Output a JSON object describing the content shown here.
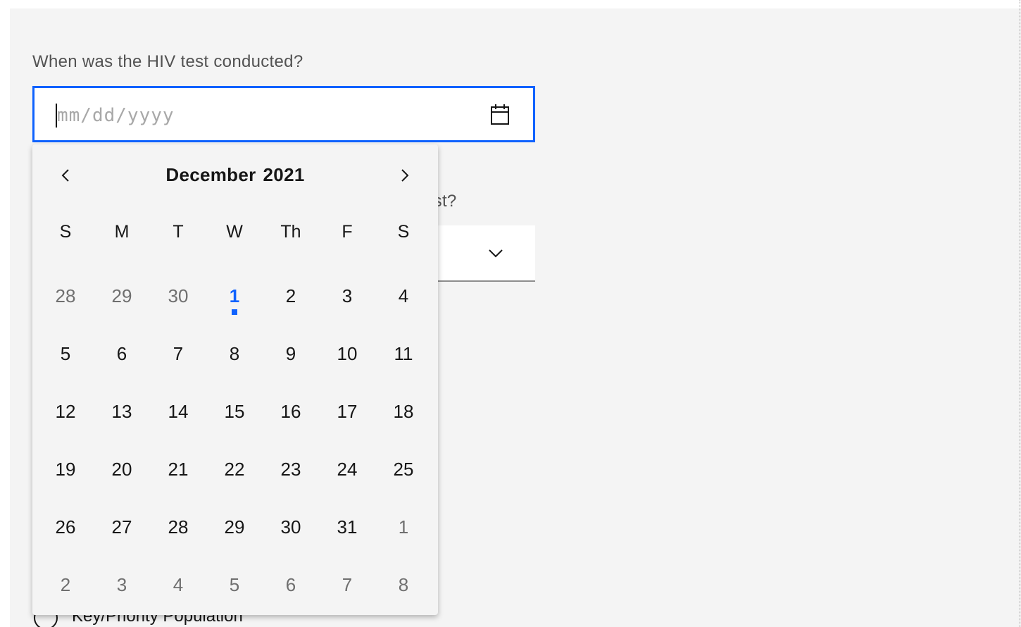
{
  "form": {
    "question1": "When was the HIV test conducted?",
    "date_placeholder": "mm/dd/yyyy",
    "question2_visible_fragment": "est?",
    "radio_option_label": "Key/Priority Population"
  },
  "icons": {
    "calendar": "calendar-icon",
    "dropdown": "chevron-down-icon",
    "prev": "chevron-left-icon",
    "next": "chevron-right-icon"
  },
  "colors": {
    "accent": "#0f62fe",
    "background": "#f4f4f4",
    "text": "#161616",
    "muted_text": "#6f6f6f",
    "label_text": "#525252"
  },
  "calendar": {
    "month": "December",
    "year": "2021",
    "weekdays": [
      "S",
      "M",
      "T",
      "W",
      "Th",
      "F",
      "S"
    ],
    "today": "1",
    "weeks": [
      [
        {
          "d": "28",
          "muted": true
        },
        {
          "d": "29",
          "muted": true
        },
        {
          "d": "30",
          "muted": true
        },
        {
          "d": "1",
          "muted": false,
          "today": true
        },
        {
          "d": "2",
          "muted": false
        },
        {
          "d": "3",
          "muted": false
        },
        {
          "d": "4",
          "muted": false
        }
      ],
      [
        {
          "d": "5",
          "muted": false
        },
        {
          "d": "6",
          "muted": false
        },
        {
          "d": "7",
          "muted": false
        },
        {
          "d": "8",
          "muted": false
        },
        {
          "d": "9",
          "muted": false
        },
        {
          "d": "10",
          "muted": false
        },
        {
          "d": "11",
          "muted": false
        }
      ],
      [
        {
          "d": "12",
          "muted": false
        },
        {
          "d": "13",
          "muted": false
        },
        {
          "d": "14",
          "muted": false
        },
        {
          "d": "15",
          "muted": false
        },
        {
          "d": "16",
          "muted": false
        },
        {
          "d": "17",
          "muted": false
        },
        {
          "d": "18",
          "muted": false
        }
      ],
      [
        {
          "d": "19",
          "muted": false
        },
        {
          "d": "20",
          "muted": false
        },
        {
          "d": "21",
          "muted": false
        },
        {
          "d": "22",
          "muted": false
        },
        {
          "d": "23",
          "muted": false
        },
        {
          "d": "24",
          "muted": false
        },
        {
          "d": "25",
          "muted": false
        }
      ],
      [
        {
          "d": "26",
          "muted": false
        },
        {
          "d": "27",
          "muted": false
        },
        {
          "d": "28",
          "muted": false
        },
        {
          "d": "29",
          "muted": false
        },
        {
          "d": "30",
          "muted": false
        },
        {
          "d": "31",
          "muted": false
        },
        {
          "d": "1",
          "muted": true
        }
      ],
      [
        {
          "d": "2",
          "muted": true
        },
        {
          "d": "3",
          "muted": true
        },
        {
          "d": "4",
          "muted": true
        },
        {
          "d": "5",
          "muted": true
        },
        {
          "d": "6",
          "muted": true
        },
        {
          "d": "7",
          "muted": true
        },
        {
          "d": "8",
          "muted": true
        }
      ]
    ]
  }
}
